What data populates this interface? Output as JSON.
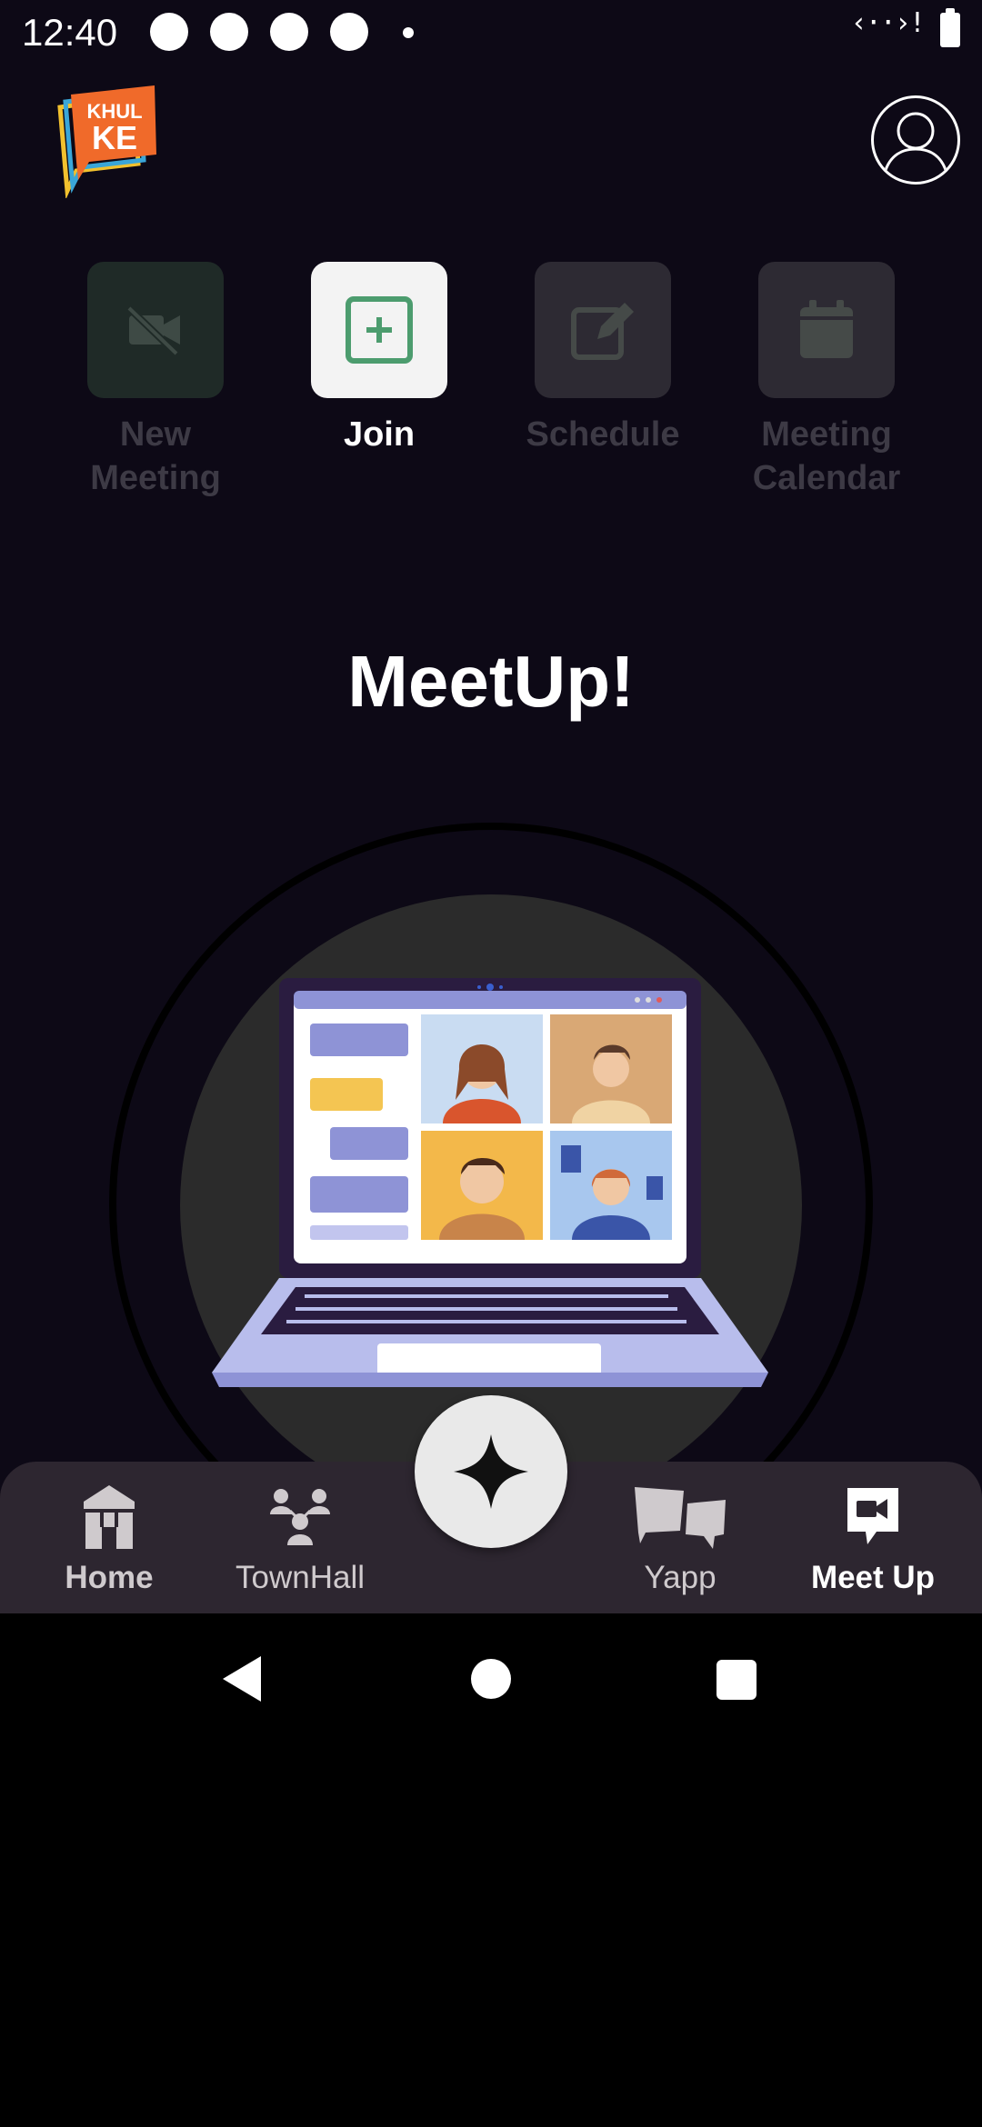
{
  "status_bar": {
    "time": "12:40"
  },
  "header": {
    "logo_text_top": "KHUL",
    "logo_text_bottom": "KE"
  },
  "actions": [
    {
      "label": "New\nMeeting",
      "icon": "video-off-icon",
      "state": "disabled"
    },
    {
      "label": "Join",
      "icon": "plus-square-icon",
      "state": "active"
    },
    {
      "label": "Schedule",
      "icon": "edit-calendar-icon",
      "state": "disabled"
    },
    {
      "label": "Meeting\nCalendar",
      "icon": "calendar-icon",
      "state": "disabled"
    }
  ],
  "main": {
    "title": "MeetUp!"
  },
  "bottom_nav": {
    "items": [
      {
        "label": "Home",
        "icon": "home-icon",
        "active": false
      },
      {
        "label": "TownHall",
        "icon": "people-icon",
        "active": false
      },
      {
        "label": "Yapp",
        "icon": "chat-bubbles-icon",
        "active": false
      },
      {
        "label": "Meet Up",
        "icon": "video-chat-icon",
        "active": true
      }
    ]
  },
  "colors": {
    "background": "#0d0916",
    "accent_green": "#4c9c6e",
    "nav_background": "#2d2630",
    "logo_orange": "#f06a2a"
  }
}
